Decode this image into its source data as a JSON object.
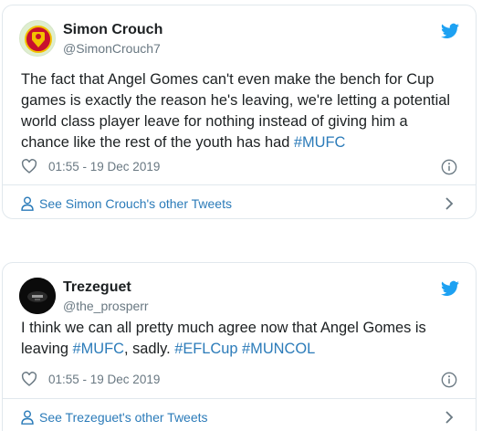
{
  "tweets": [
    {
      "author_name": "Simon Crouch",
      "author_handle": "@SimonCrouch7",
      "text_parts": [
        {
          "text": "The fact that Angel Gomes can't even make the bench for Cup games is exactly the reason he's leaving, we're letting a potential world class player leave for nothing instead of giving him a chance like the rest of the youth has had ",
          "hashtag": false
        },
        {
          "text": "#MUFC",
          "hashtag": true
        }
      ],
      "timestamp": "01:55 - 19 Dec 2019",
      "more_label": "See Simon Crouch's other Tweets"
    },
    {
      "author_name": "Trezeguet",
      "author_handle": "@the_prosperr",
      "text_parts": [
        {
          "text": "I think we can all pretty much agree now that Angel Gomes is leaving ",
          "hashtag": false
        },
        {
          "text": "#MUFC",
          "hashtag": true
        },
        {
          "text": ", sadly. ",
          "hashtag": false
        },
        {
          "text": "#EFLCup",
          "hashtag": true
        },
        {
          "text": " ",
          "hashtag": false
        },
        {
          "text": "#MUNCOL",
          "hashtag": true
        }
      ],
      "timestamp": "01:55 - 19 Dec 2019",
      "more_label": "See Trezeguet's other Tweets"
    }
  ],
  "colors": {
    "link": "#2b7bb9",
    "twitter_blue": "#1da1f2",
    "muted": "#697882",
    "border": "#e1e8ed"
  },
  "icons": [
    "twitter-bird-icon",
    "heart-icon",
    "info-icon",
    "person-icon",
    "chevron-right-icon"
  ]
}
